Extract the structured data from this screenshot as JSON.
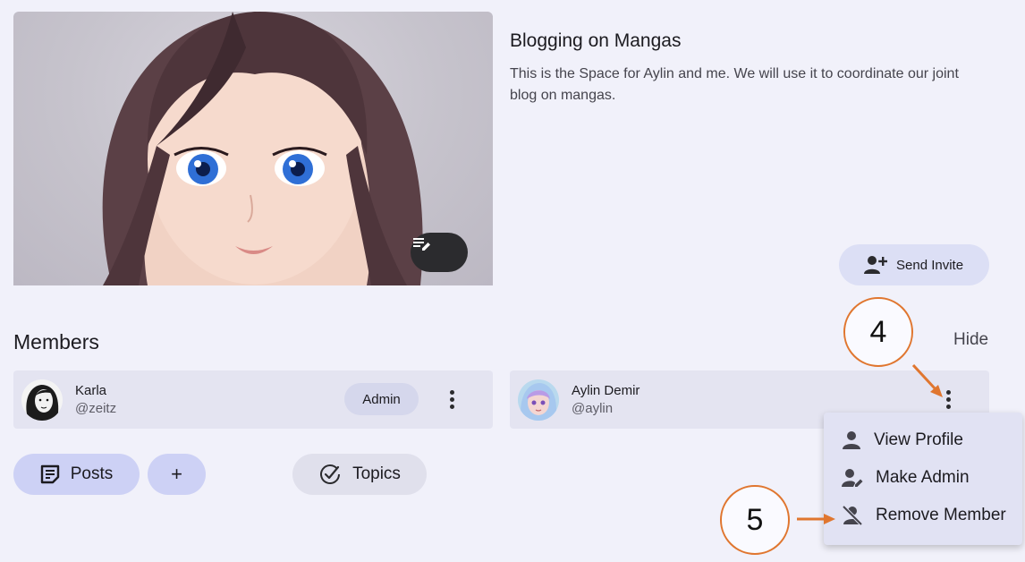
{
  "space": {
    "title": "Blogging on Mangas",
    "description": "This is the Space for Aylin and me. We will use it to coordinate our joint blog on mangas.",
    "send_invite_label": "Send Invite"
  },
  "members_section": {
    "heading": "Members",
    "hide_label": "Hide",
    "members": [
      {
        "name": "Karla",
        "handle": "@zeitz",
        "badge": "Admin"
      },
      {
        "name": "Aylin Demir",
        "handle": "@aylin"
      }
    ]
  },
  "actions": {
    "posts_label": "Posts",
    "add_label": "+",
    "topics_label": "Topics"
  },
  "member_menu": {
    "items": [
      {
        "label": "View Profile",
        "icon": "person-icon"
      },
      {
        "label": "Make Admin",
        "icon": "person-edit-icon"
      },
      {
        "label": "Remove Member",
        "icon": "person-off-icon"
      }
    ]
  },
  "callouts": {
    "first": "4",
    "second": "5"
  },
  "colors": {
    "accent": "#e0762f",
    "primary_container": "#cdd1f5",
    "menu_bg": "#e1e2f3"
  }
}
